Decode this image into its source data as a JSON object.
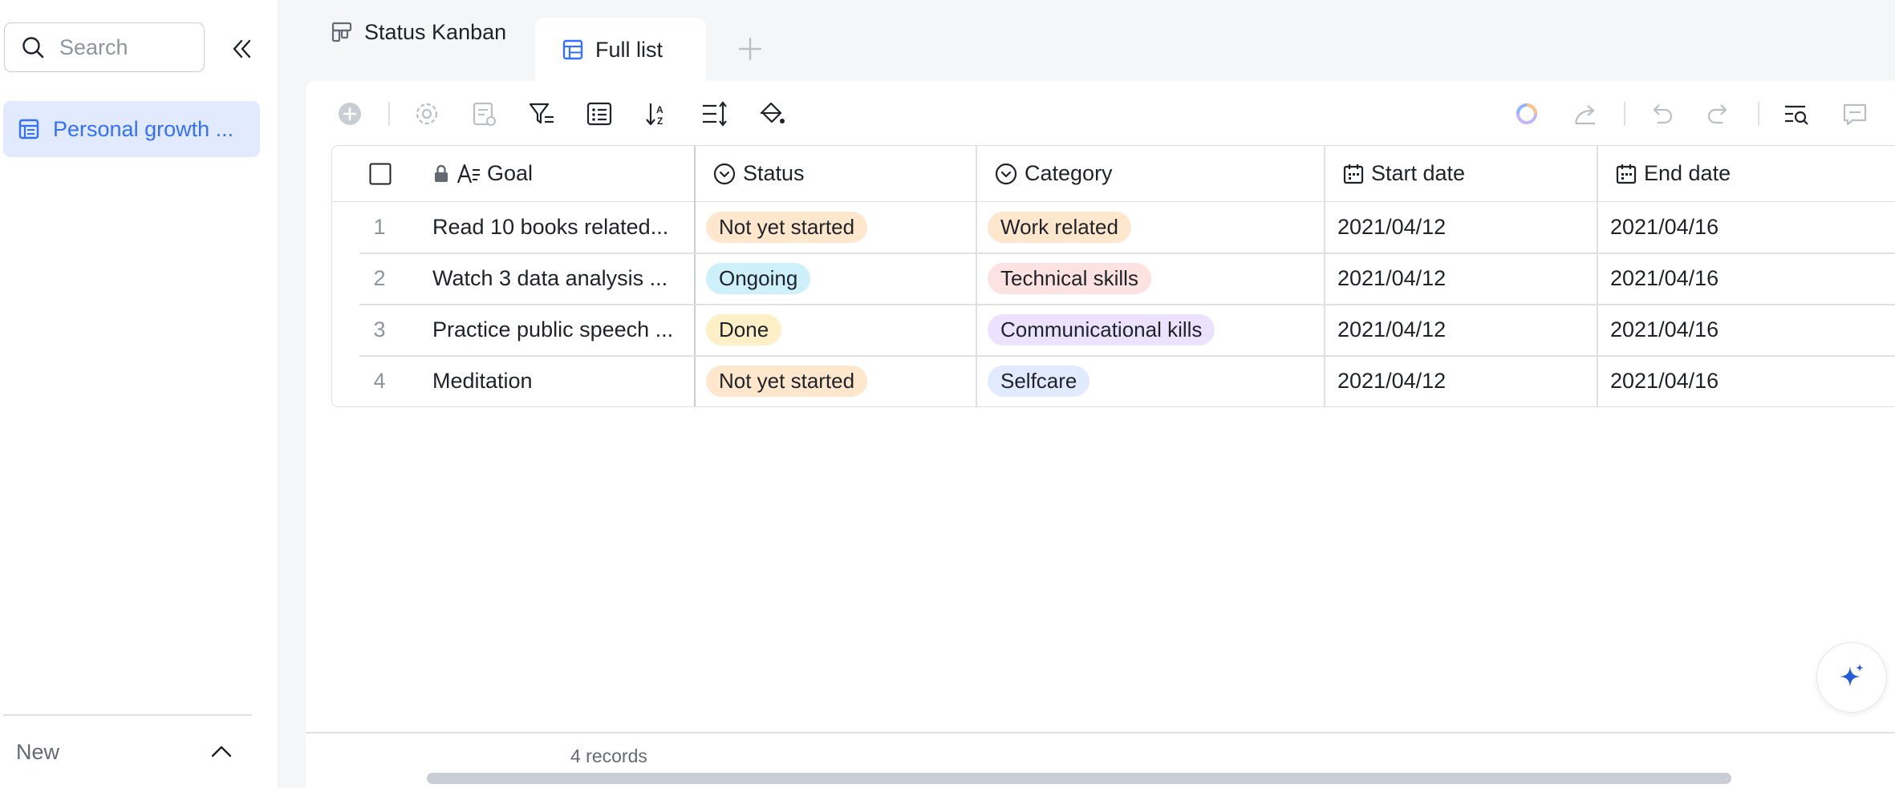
{
  "sidebar": {
    "search_placeholder": "Search",
    "items": [
      {
        "label": "Personal growth ..."
      }
    ],
    "new_label": "New"
  },
  "tabs": [
    {
      "label": "Status Kanban",
      "active": false
    },
    {
      "label": "Full list",
      "active": true
    }
  ],
  "table": {
    "columns": [
      "Goal",
      "Status",
      "Category",
      "Start date",
      "End date"
    ],
    "rows": [
      {
        "num": "1",
        "goal": "Read 10 books related...",
        "status": "Not yet started",
        "category": "Work related",
        "start": "2021/04/12",
        "end": "2021/04/16"
      },
      {
        "num": "2",
        "goal": "Watch 3 data analysis ...",
        "status": "Ongoing",
        "category": "Technical skills",
        "start": "2021/04/12",
        "end": "2021/04/16"
      },
      {
        "num": "3",
        "goal": "Practice public speech ...",
        "status": "Done",
        "category": "Communicational kills",
        "start": "2021/04/12",
        "end": "2021/04/16"
      },
      {
        "num": "4",
        "goal": "Meditation",
        "status": "Not yet started",
        "category": "Selfcare",
        "start": "2021/04/12",
        "end": "2021/04/16"
      }
    ]
  },
  "footer": {
    "records": "4 records"
  },
  "colors": {
    "accent": "#3370ff",
    "tag_not_started": "#fee7cd",
    "tag_ongoing": "#cef0fb",
    "tag_done": "#fdf0c6",
    "tag_work": "#fee7cd",
    "tag_technical": "#fde2e2",
    "tag_communication": "#ece2fe",
    "tag_selfcare": "#e1eaff"
  }
}
